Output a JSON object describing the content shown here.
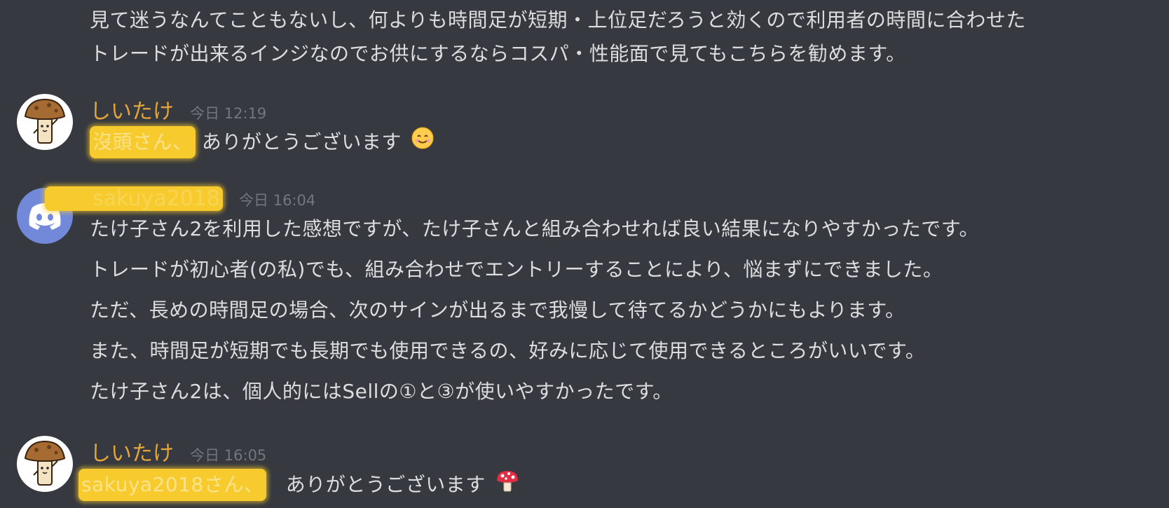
{
  "messages": [
    {
      "continuation": [
        "見て迷うなんてこともないし、何よりも時間足が短期・上位足だろうと効くので利用者の時間に合わせた",
        "トレードが出来るインジなのでお供にするならコスパ・性能面で見てもこちらを勧めます。"
      ]
    },
    {
      "author": "しいたけ",
      "timestamp": "今日 12:19",
      "mention": "沒頭さん、",
      "text": "ありがとうございます",
      "emoji": "smiling-face-emoji"
    },
    {
      "author": "sakuya2018",
      "timestamp": "今日 16:04",
      "lines": [
        "たけ子さん2を利用した感想ですが、たけ子さんと組み合わせれば良い結果になりやすかったです。",
        "トレードが初心者(の私)でも、組み合わせでエントリーすることにより、悩まずにできました。",
        "ただ、長めの時間足の場合、次のサインが出るまで我慢して待てるかどうかにもよります。",
        "また、時間足が短期でも長期でも使用できるの、好みに応じて使用できるところがいいです。",
        "たけ子さん2は、個人的にはSellの①と③が使いやすかったです。"
      ]
    },
    {
      "author": "しいたけ",
      "timestamp": "今日 16:05",
      "mention": "sakuya2018さん、",
      "text": "ありがとうございます",
      "emoji": "mushroom-emoji"
    }
  ],
  "colors": {
    "background": "#36393f",
    "text": "#dcddde",
    "author": "#e4a53b",
    "timestamp": "#72767d",
    "highlight": "#f7cb2e",
    "discord_avatar": "#7289da"
  }
}
